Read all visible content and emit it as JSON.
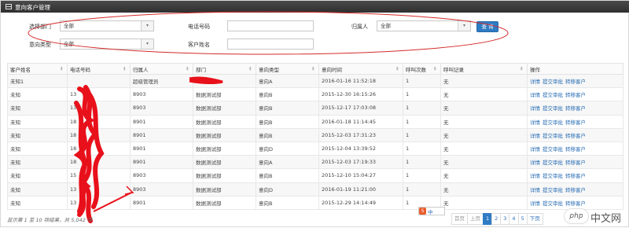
{
  "panel": {
    "title": "意向客户管理"
  },
  "filters": {
    "dept_label": "选择部门",
    "dept_value": "全部",
    "phone_label": "电话号码",
    "phone_value": "",
    "owner_label": "归属人",
    "owner_value": "全部",
    "type_label": "意向类型",
    "type_value": "全部",
    "name_label": "客户姓名",
    "name_value": "",
    "query_button": "查 询"
  },
  "table": {
    "headers": [
      "客户姓名",
      "电话号码",
      "归属人",
      "部门",
      "意向类型",
      "意向时间",
      "呼叫次数",
      "呼叫记录",
      "操作"
    ],
    "rows": [
      [
        "未知1",
        "",
        "超级管理员",
        "",
        "意向A",
        "2016-01-16 11:52:18",
        "1",
        "无"
      ],
      [
        "未知",
        "13",
        "8903",
        "数据测试部",
        "意向B",
        "2015-12-30 16:15:26",
        "1",
        "无"
      ],
      [
        "未知",
        "13",
        "8903",
        "数据测试部",
        "意向B",
        "2015-12-17 17:03:08",
        "1",
        "无"
      ],
      [
        "未知",
        "18",
        "8901",
        "数据测试部",
        "意向B",
        "2016-01-18 11:14:45",
        "1",
        "无"
      ],
      [
        "未知",
        "18",
        "8901",
        "数据测试部",
        "意向B",
        "2015-12-03 17:31:23",
        "1",
        "无"
      ],
      [
        "未知",
        "18",
        "8901",
        "数据测试部",
        "意向D",
        "2015-12-04 13:39:52",
        "1",
        "无"
      ],
      [
        "未知",
        "18",
        "8901",
        "数据测试部",
        "意向A",
        "2015-12-03 17:19:33",
        "1",
        "无"
      ],
      [
        "未知",
        "15",
        "8903",
        "数据测试部",
        "意向B",
        "2015-12-10 15:04:27",
        "1",
        "无"
      ],
      [
        "未知",
        "13",
        "8903",
        "数据测试部",
        "意向D",
        "2016-01-19 11:21:00",
        "1",
        "无"
      ],
      [
        "未知",
        "13",
        "8901",
        "数据测试部",
        "意向B",
        "2015-12-29 14:14:49",
        "1",
        "无"
      ]
    ],
    "ops": [
      "详情",
      "提交审批",
      "转移客户"
    ]
  },
  "footer": {
    "info": "显示第 1 至 10 项结果，共 5,042 项"
  },
  "pager": [
    "首页",
    "上页",
    "1",
    "2",
    "3",
    "4",
    "5",
    "下页"
  ],
  "ime": {
    "badge": "S",
    "text": "中"
  },
  "watermark": {
    "logo": "php",
    "site": "中文网"
  },
  "colors": {
    "accent": "#2f7bc4",
    "annotation": "#e8101a"
  }
}
